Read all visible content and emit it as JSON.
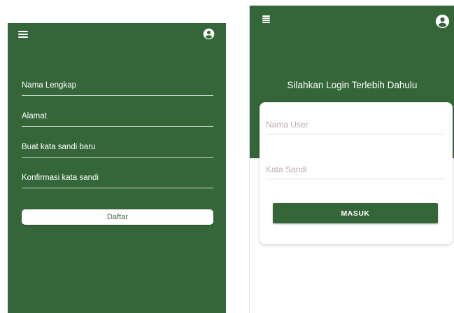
{
  "register_screen": {
    "menu_icon": "hamburger-menu-icon",
    "account_icon": "account-circle-icon",
    "fields": [
      {
        "label": "Nama Lengkap"
      },
      {
        "label": "Alamat"
      },
      {
        "label": "Buat kata sandi baru"
      },
      {
        "label": "Konfirmasi kata sandi"
      }
    ],
    "submit_label": "Daftar"
  },
  "login_screen": {
    "menu_icon": "hamburger-menu-icon",
    "account_icon": "account-circle-icon",
    "title": "Silahkan Login Terlebih Dahulu",
    "username_placeholder": "Nama User",
    "password_placeholder": "Kata Sandi",
    "submit_label": "MASUK"
  },
  "colors": {
    "primary_green": "#35663a",
    "placeholder_text": "#c0a9ad",
    "white": "#ffffff"
  }
}
